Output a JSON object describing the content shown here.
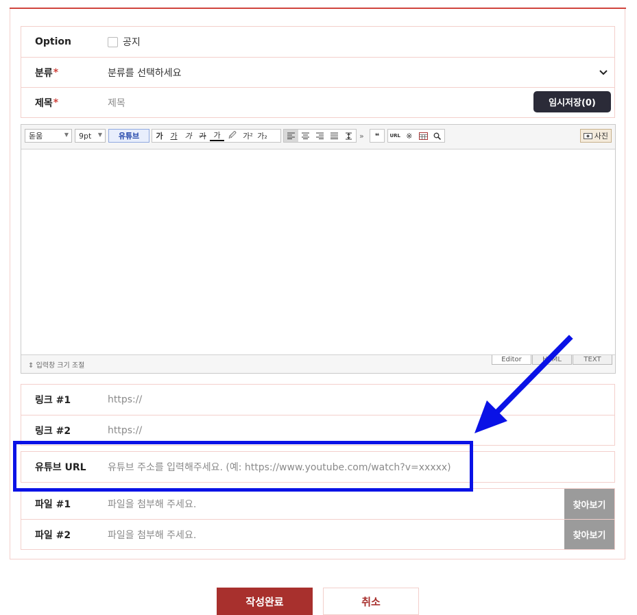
{
  "form": {
    "option": {
      "label": "Option",
      "checkbox_label": "공지"
    },
    "category": {
      "label": "분류",
      "required_mark": "*",
      "value": "분류를 선택하세요"
    },
    "title": {
      "label": "제목",
      "required_mark": "*",
      "placeholder": "제목",
      "save_button": "임시저장(0)"
    }
  },
  "editor": {
    "toolbar": {
      "font_select": "돋움",
      "size_select": "9pt",
      "youtube_button": "유튜브",
      "format_icons": [
        "가",
        "가",
        "가",
        "가",
        "가"
      ],
      "color_icon": "🖉",
      "sup_icon": "가²",
      "sub_icon": "가₂",
      "quote_icon": "❝",
      "url_icon": "URL",
      "special_char_icon": "※",
      "more_icon": "»",
      "photo_button": "사진"
    },
    "footer": {
      "resize_label": "입력창 크기 조절",
      "tabs": [
        "Editor",
        "HTML",
        "TEXT"
      ]
    }
  },
  "links": [
    {
      "label": "링크 #1",
      "placeholder": "https://"
    },
    {
      "label": "링크 #2",
      "placeholder": "https://"
    }
  ],
  "youtube": {
    "label": "유튜브 URL",
    "placeholder": "유튜브 주소를 입력해주세요. (예: https://www.youtube.com/watch?v=xxxxx)"
  },
  "files": [
    {
      "label": "파일 #1",
      "placeholder": "파일을 첨부해 주세요.",
      "button": "찾아보기"
    },
    {
      "label": "파일 #2",
      "placeholder": "파일을 첨부해 주세요.",
      "button": "찾아보기"
    }
  ],
  "actions": {
    "submit": "작성완료",
    "cancel": "취소"
  },
  "colors": {
    "accent": "#d0433c",
    "submit_bg": "#a8302d",
    "highlight": "#0a12e6",
    "save_bg": "#2b2b38"
  }
}
